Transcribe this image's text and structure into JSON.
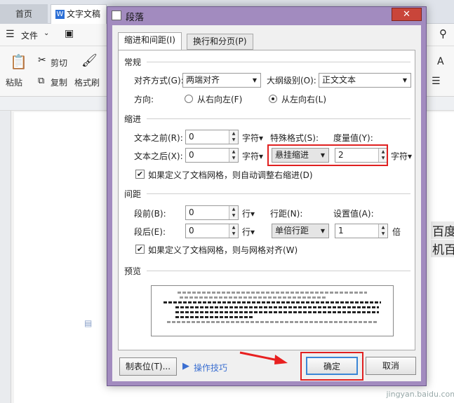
{
  "app": {
    "tabs": {
      "home": "首页",
      "doc": "文字文稿"
    },
    "menu": {
      "file": "文件"
    },
    "ribbon": {
      "paste": "粘贴",
      "cut": "剪切",
      "copy": "复制",
      "format_painter": "格式刷"
    },
    "document_text": [
      "百度",
      "机百"
    ],
    "watermark": "jingyan.baidu.com"
  },
  "dialog": {
    "title": "段落",
    "close": "✕",
    "tabs": [
      "缩进和间距(I)",
      "换行和分页(P)"
    ],
    "general": {
      "section": "常规",
      "alignment_label": "对齐方式(G):",
      "alignment_value": "两端对齐",
      "outline_label": "大纲级别(O):",
      "outline_value": "正文文本",
      "direction_label": "方向:",
      "rtl_label": "从右向左(F)",
      "ltr_label": "从左向右(L)"
    },
    "indent": {
      "section": "缩进",
      "before_label": "文本之前(R):",
      "before_value": "0",
      "after_label": "文本之后(X):",
      "after_value": "0",
      "unit": "字符▾",
      "special_label": "特殊格式(S):",
      "special_value": "悬挂缩进",
      "measure_label": "度量值(Y):",
      "measure_value": "2",
      "measure_unit": "字符▾",
      "auto_adjust": "如果定义了文档网格，则自动调整右缩进(D)"
    },
    "spacing": {
      "section": "间距",
      "before_label": "段前(B):",
      "before_value": "0",
      "after_label": "段后(E):",
      "after_value": "0",
      "unit": "行▾",
      "line_label": "行距(N):",
      "line_value": "单倍行距",
      "setting_label": "设置值(A):",
      "setting_value": "1",
      "setting_unit": "倍",
      "snap_grid": "如果定义了文档网格，则与网格对齐(W)"
    },
    "preview": {
      "section": "预览"
    },
    "buttons": {
      "tabs": "制表位(T)...",
      "tips": "操作技巧",
      "ok": "确定",
      "cancel": "取消"
    }
  }
}
